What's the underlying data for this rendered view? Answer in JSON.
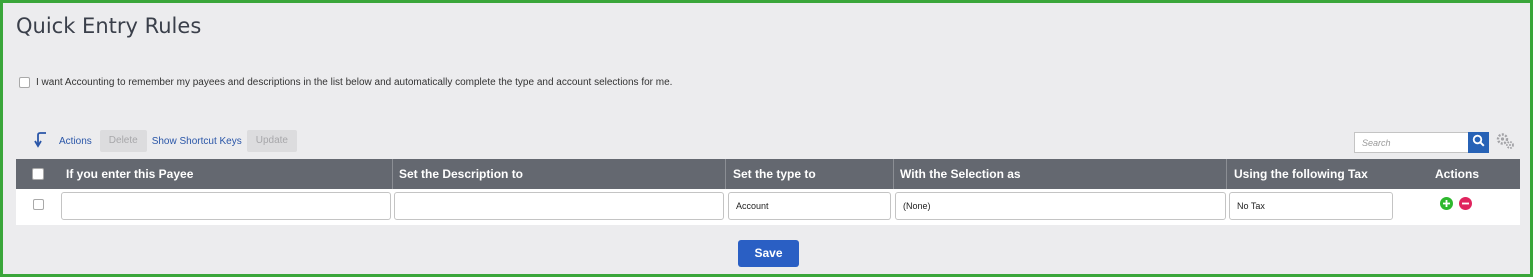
{
  "page": {
    "title": "Quick Entry Rules"
  },
  "remember_option": {
    "label": "I want Accounting to remember my payees and descriptions in the list below and automatically complete the type and account selections for me.",
    "checked": false
  },
  "toolbar": {
    "actions_label": "Actions",
    "delete_label": "Delete",
    "shortcut_label": "Show Shortcut Keys",
    "update_label": "Update"
  },
  "search": {
    "placeholder": "Search",
    "icon": "search-icon"
  },
  "settings": {
    "icon": "gear-icon"
  },
  "table": {
    "columns": {
      "payee": "If you enter this Payee",
      "description": "Set the Description to",
      "type": "Set the type to",
      "selection": "With the Selection as",
      "tax": "Using the following Tax",
      "actions": "Actions"
    },
    "row": {
      "payee": "",
      "description": "",
      "type": "Account",
      "selection": "(None)",
      "tax": "No Tax"
    }
  },
  "save_label": "Save",
  "colors": {
    "border": "#3aa63a",
    "header_bg": "#646870",
    "accent": "#2a5fc4",
    "add": "#2eb82e",
    "remove": "#e0245e"
  }
}
